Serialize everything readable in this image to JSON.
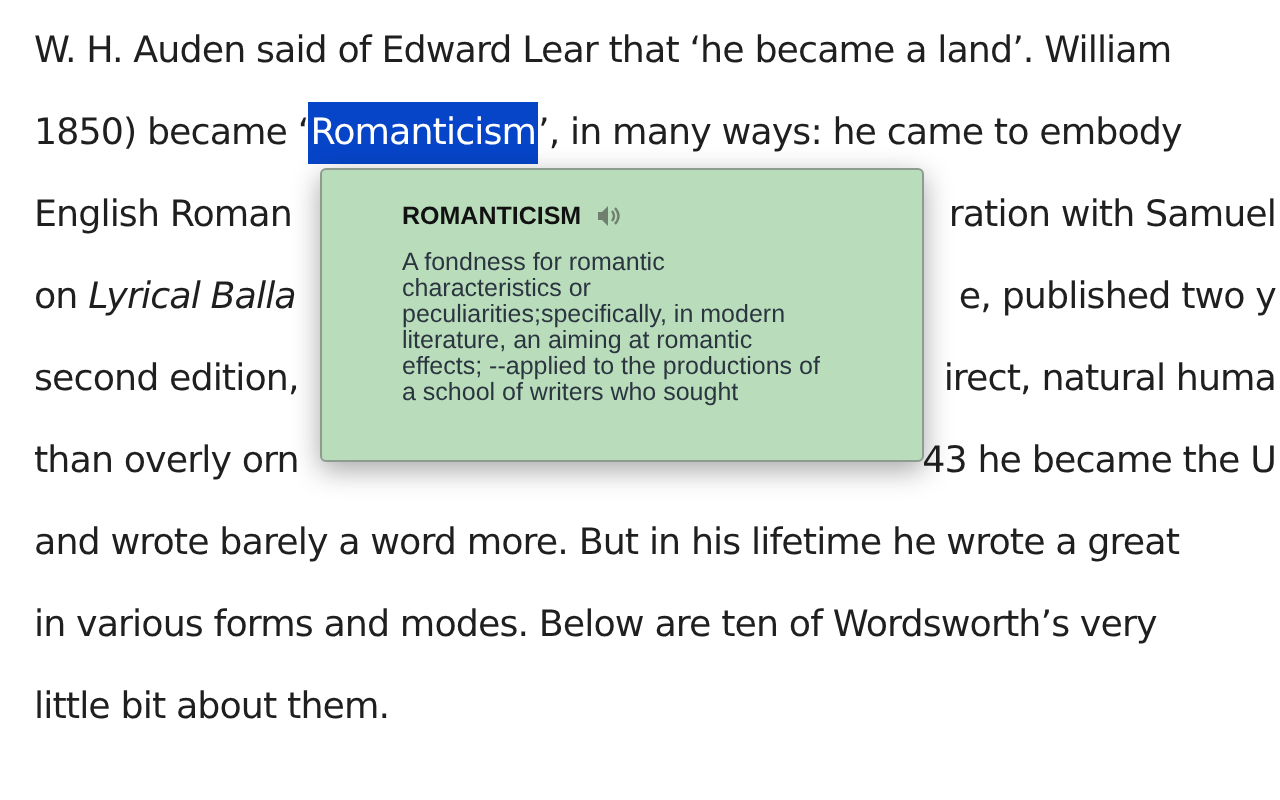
{
  "article": {
    "lines": [
      {
        "segments": [
          {
            "text": "W. H. Auden said of Edward Lear that ‘he became a land’. William",
            "selected": false
          }
        ]
      },
      {
        "segments": [
          {
            "text": "1850) became ‘",
            "selected": false
          },
          {
            "text": "Romanticism",
            "selected": true
          },
          {
            "text": "’, in many ways: he came to embody",
            "selected": false
          }
        ]
      },
      {
        "segments": [
          {
            "text": "English Roman",
            "selected": false
          }
        ],
        "right": "ration with Samuel"
      },
      {
        "segments": [
          {
            "text": "on *Lyrical Balla*",
            "selected": false
          }
        ],
        "right": "e, published two y"
      },
      {
        "segments": [
          {
            "text": "second edition,",
            "selected": false
          }
        ],
        "right": "irect, natural huma"
      },
      {
        "segments": [
          {
            "text": "than overly orn",
            "selected": false
          }
        ],
        "right": "43 he became the U"
      },
      {
        "segments": [
          {
            "text": "and wrote barely a word more. But in his lifetime he wrote a great",
            "selected": false
          }
        ]
      },
      {
        "segments": [
          {
            "text": "in various forms and modes. Below are ten of Wordsworth’s very",
            "selected": false
          }
        ]
      },
      {
        "segments": [
          {
            "text": "little bit about them.",
            "selected": false
          }
        ]
      }
    ]
  },
  "definition_popup": {
    "word": "ROMANTICISM",
    "definition": "A fondness for romantic characteristics or peculiarities;specifically, in modern literature, an aiming at romantic effects; --applied to the productions of a school of writers who sought"
  }
}
